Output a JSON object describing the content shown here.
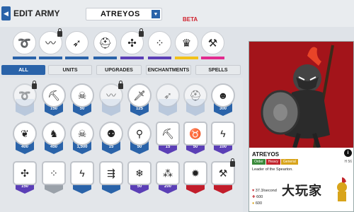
{
  "header": {
    "back_icon": "back-icon",
    "title": "EDIT ARMY",
    "army_name": "ATREYOS",
    "beta": "BETA"
  },
  "slots": [
    {
      "icon": "lasso-icon",
      "glyph": "➰",
      "bar": "#2a63a9",
      "locked": false
    },
    {
      "icon": "whip-icon",
      "glyph": "〰",
      "bar": "#2a63a9",
      "locked": true
    },
    {
      "icon": "bow-icon",
      "glyph": "➶",
      "bar": "#2a63a9",
      "locked": false
    },
    {
      "icon": "helmet-icon",
      "glyph": "⛑",
      "bar": "#2a63a9",
      "locked": false
    },
    {
      "icon": "statue-icon",
      "glyph": "✣",
      "bar": "#5b3fb6",
      "locked": true
    },
    {
      "icon": "spell-icon",
      "glyph": "⁘",
      "bar": "#5b3fb6",
      "locked": false
    },
    {
      "icon": "crown-icon",
      "glyph": "♛",
      "bar": "#f2c21b",
      "locked": false
    },
    {
      "icon": "anvil-icon",
      "glyph": "⚒",
      "bar": "#e22c8f",
      "locked": false
    }
  ],
  "tabs": [
    "ALL",
    "UNITS",
    "UPGRADES",
    "ENCHANTMENTS",
    "SPELLS"
  ],
  "units": [
    {
      "icon": "lasso-icon",
      "glyph": "➰",
      "cost": "",
      "style": "dim",
      "locked": true
    },
    {
      "icon": "pickaxe-icon",
      "glyph": "⛏",
      "cost": "150",
      "style": "",
      "locked": false
    },
    {
      "icon": "skull-icon",
      "glyph": "☠",
      "cost": "50",
      "style": "",
      "locked": false
    },
    {
      "icon": "whip-icon",
      "glyph": "〰",
      "cost": "",
      "style": "dim",
      "locked": true
    },
    {
      "icon": "sword-icon",
      "glyph": "🗡",
      "cost": "125",
      "style": "",
      "locked": false
    },
    {
      "icon": "bow-icon",
      "glyph": "➶",
      "cost": "",
      "style": "dim",
      "locked": false
    },
    {
      "icon": "helmet-icon",
      "glyph": "⛑",
      "cost": "",
      "style": "dim",
      "locked": false
    },
    {
      "icon": "mask-icon",
      "glyph": "☻",
      "cost": "300",
      "style": "",
      "locked": false
    },
    {
      "icon": "lungs-icon",
      "glyph": "❦",
      "cost": "400",
      "style": "",
      "locked": false
    },
    {
      "icon": "horse-icon",
      "glyph": "♞",
      "cost": "450",
      "style": "",
      "locked": false
    },
    {
      "icon": "giant-icon",
      "glyph": "☠",
      "cost": "1,500",
      "style": "",
      "locked": false
    },
    {
      "icon": "spearhead-icon",
      "glyph": "⚉",
      "cost": "15",
      "style": "",
      "locked": false
    },
    {
      "icon": "witch-icon",
      "glyph": "⚲",
      "cost": "50",
      "style": "",
      "locked": false
    },
    {
      "icon": "pickaxe-upgrade-icon",
      "glyph": "⛏",
      "cost": "15",
      "style": "purple",
      "locked": false,
      "hex": true
    },
    {
      "icon": "beast-icon",
      "glyph": "♉",
      "cost": "50",
      "style": "purple",
      "locked": false,
      "hex": true
    },
    {
      "icon": "claw-icon",
      "glyph": "ϟ",
      "cost": "100",
      "style": "purple",
      "locked": false,
      "hex": true
    },
    {
      "icon": "statue-icon",
      "glyph": "✣",
      "cost": "150",
      "style": "purple",
      "locked": false,
      "hex": true
    },
    {
      "icon": "spell-icon",
      "glyph": "⁘",
      "cost": "",
      "style": "gray",
      "locked": false,
      "hex": true
    },
    {
      "icon": "lightning-icon",
      "glyph": "ϟ",
      "cost": "",
      "style": "",
      "locked": false,
      "hex": true
    },
    {
      "icon": "arrows-icon",
      "glyph": "⇶",
      "cost": "",
      "style": "",
      "locked": false,
      "hex": true
    },
    {
      "icon": "snow-icon",
      "glyph": "❄",
      "cost": "50",
      "style": "purple",
      "locked": false,
      "hex": true
    },
    {
      "icon": "army-icon",
      "glyph": "⁂",
      "cost": "200",
      "style": "purple",
      "locked": false,
      "hex": true
    },
    {
      "icon": "bomb-icon",
      "glyph": "✹",
      "cost": "",
      "style": "red",
      "locked": false,
      "hex": true
    },
    {
      "icon": "tools-icon",
      "glyph": "⚒",
      "cost": "",
      "style": "red",
      "locked": true,
      "hex": true
    }
  ],
  "panel": {
    "name": "ATREYOS",
    "info": "i",
    "badges": [
      {
        "label": "Order",
        "color": "#3a8a3a"
      },
      {
        "label": "Heavy",
        "color": "#c2252c"
      },
      {
        "label": "General",
        "color": "#d8a41b"
      }
    ],
    "side_label": "H 56",
    "description": "Leader of the Spearton.",
    "stats": [
      "37.3/second",
      "600",
      "600"
    ],
    "portrait_bg": "#a3141a"
  },
  "watermark": "大玩家"
}
